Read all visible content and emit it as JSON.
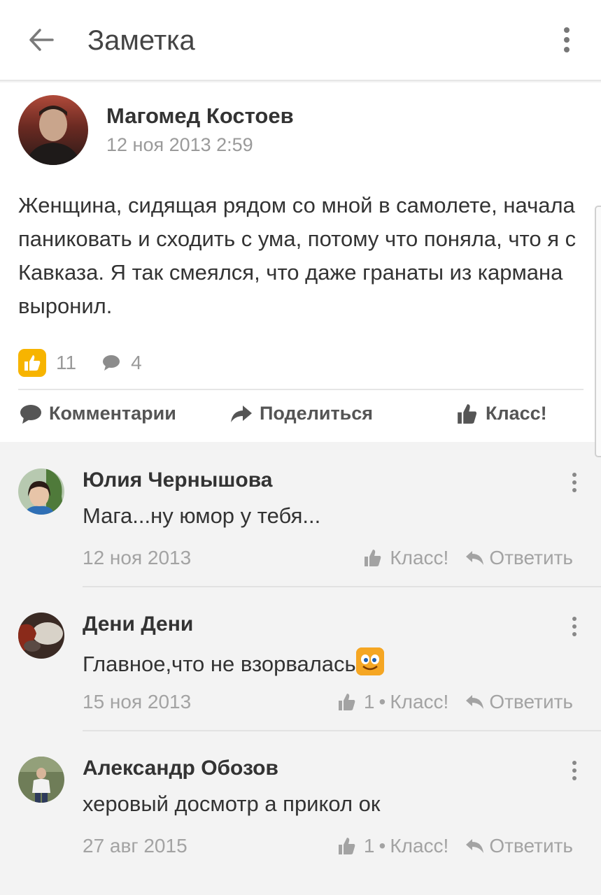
{
  "header": {
    "title": "Заметка",
    "back_icon": "arrow-left-icon",
    "menu_icon": "more-vertical-icon"
  },
  "post": {
    "author": "Магомед Костоев",
    "date": "12 ноя 2013 2:59",
    "text": "Женщина, сидящая рядом со мной в самолете, начала паниковать и сходить с ума, потому что поняла, что я с Кавказа. Я так смеялся, что даже гранаты из кармана выронил.",
    "likes": "11",
    "comments_count": "4",
    "accent_color": "#f7b400"
  },
  "actions": {
    "comments": "Комментарии",
    "share": "Поделиться",
    "klass": "Класс!"
  },
  "comments": [
    {
      "name": "Юлия Чернышова",
      "text": "Мага...ну юмор у тебя...",
      "date": "12 ноя 2013",
      "klass": "Класс!",
      "reply": "Ответить"
    },
    {
      "name": "Дени Дени",
      "text": "Главное,что не взорвалась",
      "date": "15 ноя 2013",
      "count": "1",
      "dot": "•",
      "klass": "Класс!",
      "reply": "Ответить"
    },
    {
      "name": "Александр Обозов",
      "text": "херовый  досмотр  а прикол ок",
      "date": "27 авг 2015",
      "count": "1",
      "dot": "•",
      "klass": "Класс!",
      "reply": "Ответить"
    }
  ]
}
